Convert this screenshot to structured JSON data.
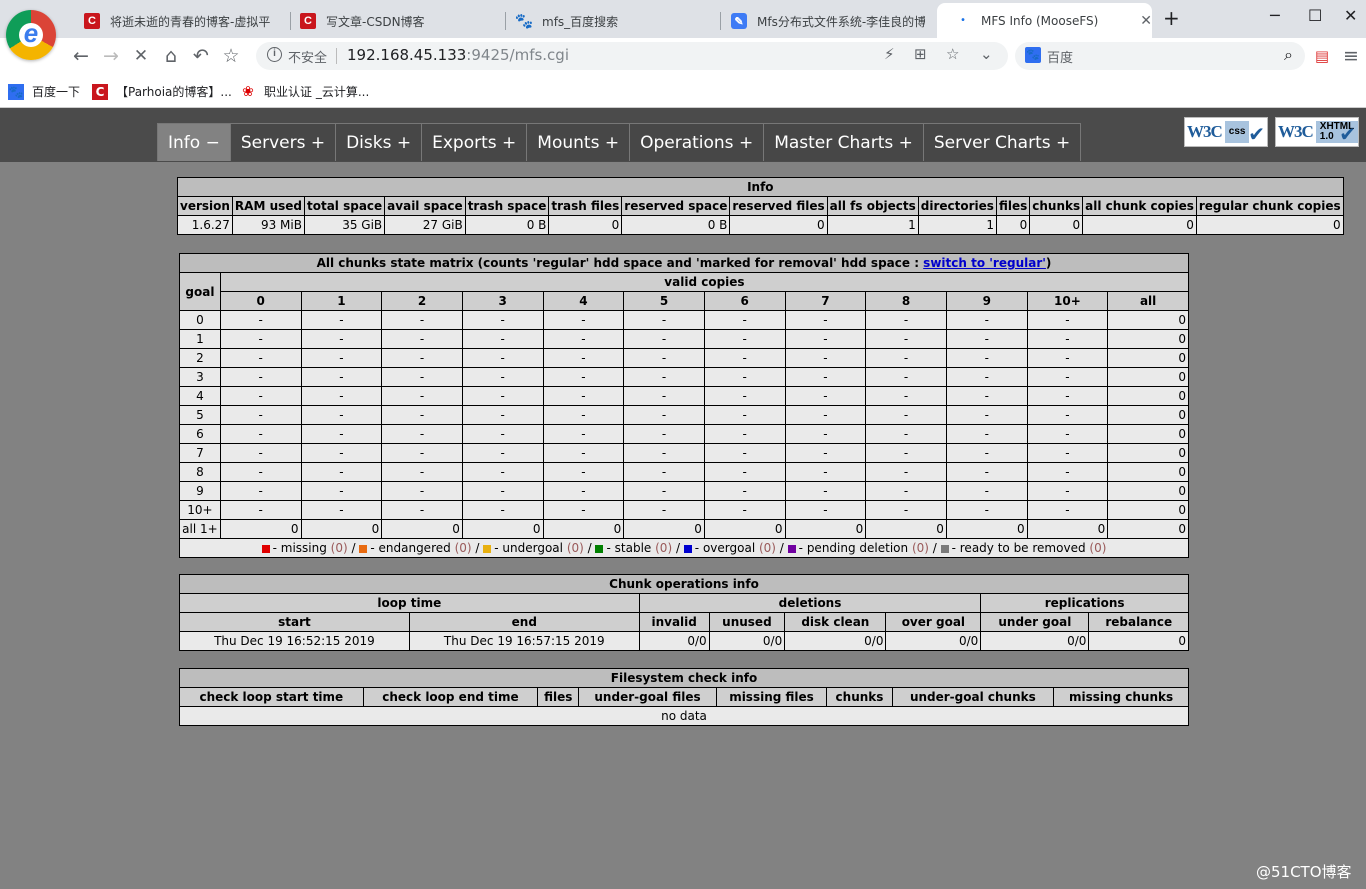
{
  "browser": {
    "tabs": [
      {
        "title": "将逝未逝的青春的博客-虚拟平台",
        "favicon": "csdn-c-icon"
      },
      {
        "title": "写文章-CSDN博客",
        "favicon": "csdn-c-icon"
      },
      {
        "title": "mfs_百度搜索",
        "favicon": "baidu-paw-icon"
      },
      {
        "title": "Mfs分布式文件系统-李佳良的博",
        "favicon": "doc-icon"
      },
      {
        "title": "MFS Info (MooseFS)",
        "favicon": "loading-dot-icon"
      }
    ],
    "security_label": "不安全",
    "url_host": "192.168.45.133",
    "url_path": ":9425/mfs.cgi",
    "search_engine": "百度",
    "bookmarks": [
      {
        "label": "百度一下",
        "icon": "baidu-paw-icon"
      },
      {
        "label": "【Parhoia的博客】...",
        "icon": "csdn-c-icon"
      },
      {
        "label": "职业认证 _云计算...",
        "icon": "huawei-icon"
      }
    ]
  },
  "menu": [
    {
      "label": "Info −",
      "active": true
    },
    {
      "label": "Servers +"
    },
    {
      "label": "Disks +"
    },
    {
      "label": "Exports +"
    },
    {
      "label": "Mounts +"
    },
    {
      "label": "Operations +"
    },
    {
      "label": "Master Charts +"
    },
    {
      "label": "Server Charts +"
    }
  ],
  "badges": {
    "css": [
      "css"
    ],
    "xhtml": [
      "XHTML",
      "1.0"
    ]
  },
  "info": {
    "title": "Info",
    "headers": [
      "version",
      "RAM used",
      "total space",
      "avail space",
      "trash space",
      "trash files",
      "reserved space",
      "reserved files",
      "all fs objects",
      "directories",
      "files",
      "chunks",
      "all chunk copies",
      "regular chunk copies"
    ],
    "values": [
      "1.6.27",
      "93 MiB",
      "35 GiB",
      "27 GiB",
      "0 B",
      "0",
      "0 B",
      "0",
      "1",
      "1",
      "0",
      "0",
      "0",
      "0"
    ]
  },
  "matrix": {
    "title_prefix": "All chunks state matrix (counts 'regular' hdd space and 'marked for removal' hdd space : ",
    "switch_link": "switch to 'regular'",
    "title_suffix": ")",
    "goal_label": "goal",
    "valid_label": "valid copies",
    "columns": [
      "0",
      "1",
      "2",
      "3",
      "4",
      "5",
      "6",
      "7",
      "8",
      "9",
      "10+",
      "all"
    ],
    "rows": [
      {
        "goal": "0",
        "cells": [
          "-",
          "-",
          "-",
          "-",
          "-",
          "-",
          "-",
          "-",
          "-",
          "-",
          "-",
          "0"
        ]
      },
      {
        "goal": "1",
        "cells": [
          "-",
          "-",
          "-",
          "-",
          "-",
          "-",
          "-",
          "-",
          "-",
          "-",
          "-",
          "0"
        ]
      },
      {
        "goal": "2",
        "cells": [
          "-",
          "-",
          "-",
          "-",
          "-",
          "-",
          "-",
          "-",
          "-",
          "-",
          "-",
          "0"
        ]
      },
      {
        "goal": "3",
        "cells": [
          "-",
          "-",
          "-",
          "-",
          "-",
          "-",
          "-",
          "-",
          "-",
          "-",
          "-",
          "0"
        ]
      },
      {
        "goal": "4",
        "cells": [
          "-",
          "-",
          "-",
          "-",
          "-",
          "-",
          "-",
          "-",
          "-",
          "-",
          "-",
          "0"
        ]
      },
      {
        "goal": "5",
        "cells": [
          "-",
          "-",
          "-",
          "-",
          "-",
          "-",
          "-",
          "-",
          "-",
          "-",
          "-",
          "0"
        ]
      },
      {
        "goal": "6",
        "cells": [
          "-",
          "-",
          "-",
          "-",
          "-",
          "-",
          "-",
          "-",
          "-",
          "-",
          "-",
          "0"
        ]
      },
      {
        "goal": "7",
        "cells": [
          "-",
          "-",
          "-",
          "-",
          "-",
          "-",
          "-",
          "-",
          "-",
          "-",
          "-",
          "0"
        ]
      },
      {
        "goal": "8",
        "cells": [
          "-",
          "-",
          "-",
          "-",
          "-",
          "-",
          "-",
          "-",
          "-",
          "-",
          "-",
          "0"
        ]
      },
      {
        "goal": "9",
        "cells": [
          "-",
          "-",
          "-",
          "-",
          "-",
          "-",
          "-",
          "-",
          "-",
          "-",
          "-",
          "0"
        ]
      },
      {
        "goal": "10+",
        "cells": [
          "-",
          "-",
          "-",
          "-",
          "-",
          "-",
          "-",
          "-",
          "-",
          "-",
          "-",
          "0"
        ]
      },
      {
        "goal": "all 1+",
        "cells": [
          "0",
          "0",
          "0",
          "0",
          "0",
          "0",
          "0",
          "0",
          "0",
          "0",
          "0",
          "0"
        ]
      }
    ],
    "legend": [
      {
        "color": "#e00000",
        "label": "missing",
        "count": "(0)"
      },
      {
        "color": "#e86a10",
        "label": "endangered",
        "count": "(0)"
      },
      {
        "color": "#e8b010",
        "label": "undergoal",
        "count": "(0)"
      },
      {
        "color": "#008000",
        "label": "stable",
        "count": "(0)"
      },
      {
        "color": "#0000d0",
        "label": "overgoal",
        "count": "(0)"
      },
      {
        "color": "#7000a0",
        "label": "pending deletion",
        "count": "(0)"
      },
      {
        "color": "#7a7a7a",
        "label": "ready to be removed",
        "count": "(0)"
      }
    ]
  },
  "chunkops": {
    "title": "Chunk operations info",
    "group_loop": "loop time",
    "group_del": "deletions",
    "group_rep": "replications",
    "headers": [
      "start",
      "end",
      "invalid",
      "unused",
      "disk clean",
      "over goal",
      "under goal",
      "rebalance"
    ],
    "values": [
      "Thu Dec 19 16:52:15 2019",
      "Thu Dec 19 16:57:15 2019",
      "0/0",
      "0/0",
      "0/0",
      "0/0",
      "0/0",
      "0"
    ]
  },
  "fscheck": {
    "title": "Filesystem check info",
    "headers": [
      "check loop start time",
      "check loop end time",
      "files",
      "under-goal files",
      "missing files",
      "chunks",
      "under-goal chunks",
      "missing chunks"
    ],
    "empty": "no data"
  },
  "watermark": "@51CTO博客"
}
